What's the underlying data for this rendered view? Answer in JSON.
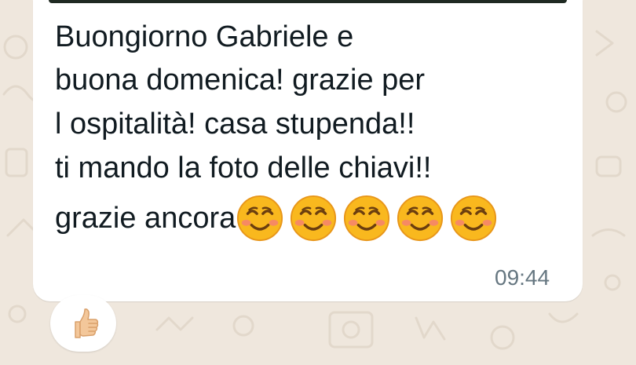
{
  "message": {
    "lines": [
      "Buongiorno Gabriele e",
      "buona domenica! grazie per",
      "l ospitalità! casa stupenda!!",
      "ti mando la foto delle chiavi!!"
    ],
    "last_line_text": "grazie ancora",
    "last_line_emojis": [
      "smiling-face-with-smiling-eyes",
      "smiling-face-with-smiling-eyes",
      "smiling-face-with-smiling-eyes",
      "smiling-face-with-smiling-eyes",
      "smiling-face-with-smiling-eyes"
    ],
    "time": "09:44",
    "reaction": "thumbs-up"
  },
  "colors": {
    "wallpaper": "#efe7dd",
    "bubble": "#ffffff",
    "text": "#111b21",
    "timestamp": "#667781"
  }
}
